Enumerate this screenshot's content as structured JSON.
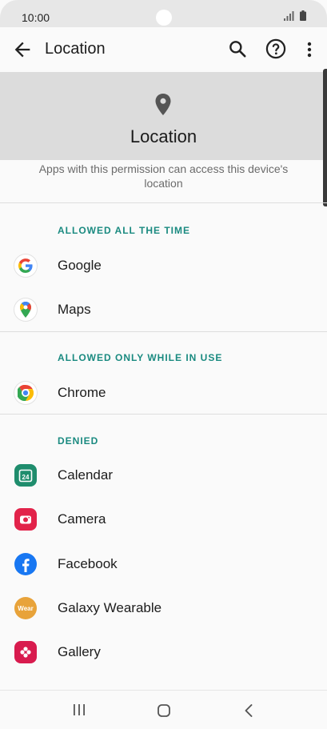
{
  "status": {
    "time": "10:00"
  },
  "app_bar": {
    "title": "Location"
  },
  "hero": {
    "title": "Location"
  },
  "description": "Apps with this permission can access this device's location",
  "sections": [
    {
      "label": "ALLOWED ALL THE TIME",
      "apps": [
        "Google",
        "Maps"
      ]
    },
    {
      "label": "ALLOWED ONLY WHILE IN USE",
      "apps": [
        "Chrome"
      ]
    },
    {
      "label": "DENIED",
      "apps": [
        "Calendar",
        "Camera",
        "Facebook",
        "Galaxy Wearable",
        "Gallery"
      ]
    }
  ],
  "icons": {
    "calendar_day": "24",
    "wear_label": "Wear"
  },
  "colors": {
    "accent": "#1a8a80",
    "calendar": "#1f8d6d",
    "camera": "#e2234a",
    "facebook": "#1877f2",
    "wearable": "#e8a33a",
    "gallery": "#d81b4e"
  }
}
